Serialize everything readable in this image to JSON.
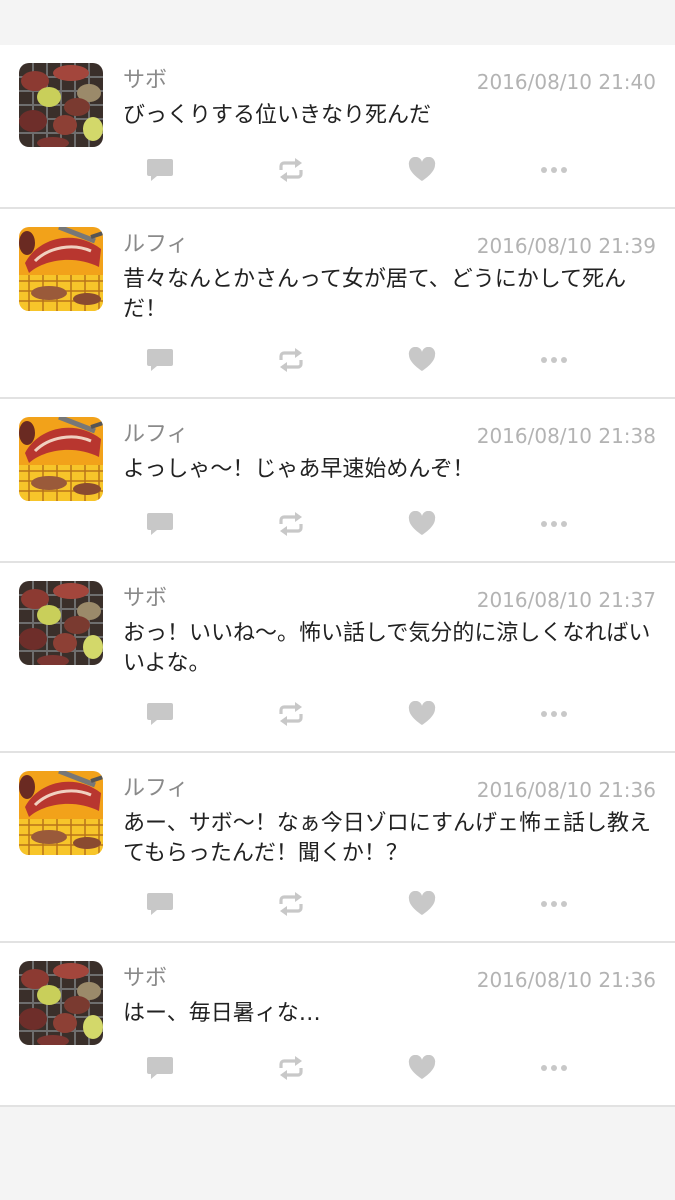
{
  "colors": {
    "page_background": "#f4f4f4",
    "card_background": "#ffffff",
    "divider": "#e2e2e2",
    "name_text": "#8a8a8a",
    "timestamp_text": "#b3b3b3",
    "body_text": "#222222",
    "action_icon": "#c8c8c8"
  },
  "posts": [
    {
      "name": "サボ",
      "avatar": "grilled-meat-vegetables-avatar",
      "time": "2016/08/10 21:40",
      "text": "びっくりする位いきなり死んだ"
    },
    {
      "name": "ルフィ",
      "avatar": "flaming-grill-meat-avatar",
      "time": "2016/08/10 21:39",
      "text": "昔々なんとかさんって女が居て、どうにかして死んだ！"
    },
    {
      "name": "ルフィ",
      "avatar": "flaming-grill-meat-avatar",
      "time": "2016/08/10 21:38",
      "text": "よっしゃ〜！じゃあ早速始めんぞ！"
    },
    {
      "name": "サボ",
      "avatar": "grilled-meat-vegetables-avatar",
      "time": "2016/08/10 21:37",
      "text": "おっ！いいね〜。怖い話しで気分的に涼しくなればいいよな。"
    },
    {
      "name": "ルフィ",
      "avatar": "flaming-grill-meat-avatar",
      "time": "2016/08/10 21:36",
      "text": "あー、サボ〜！なぁ今日ゾロにすんげェ怖ェ話し教えてもらったんだ！聞くか！？"
    },
    {
      "name": "サボ",
      "avatar": "grilled-meat-vegetables-avatar",
      "time": "2016/08/10 21:36",
      "text": "はー、毎日暑ィな…"
    }
  ]
}
